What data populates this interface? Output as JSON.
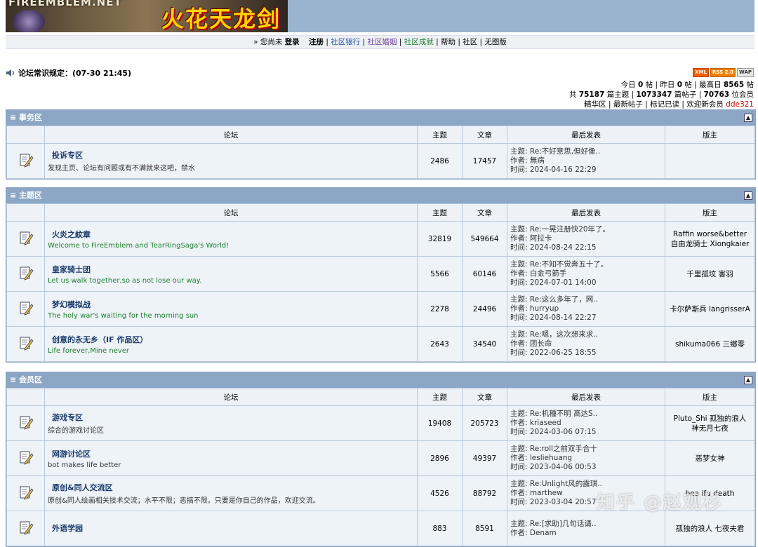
{
  "banner": {
    "logo": "FIREEMBLEM.NET",
    "title": "火花天龙剑"
  },
  "topnav": {
    "prefix": "» 您尚未",
    "login": "登录",
    "register": "注册",
    "items": [
      "社区银行",
      "社区婚姻",
      "社区成就",
      "帮助",
      "社区",
      "无图版"
    ],
    "sep": "|"
  },
  "notice": {
    "text": "论坛常识规定：(07-30 21:45)"
  },
  "badges": [
    "XML",
    "RSS 2.0",
    "WAP"
  ],
  "stats": {
    "today_label": "今日",
    "today": "0",
    "tie": "帖",
    "yesterday_label": "昨日",
    "yesterday": "0",
    "max_label": "最高日",
    "max": "8565",
    "total_label": "共",
    "topics": "75187",
    "topics_unit": "篇主题",
    "posts": "1073347",
    "posts_unit": "篇帖子",
    "members": "70763",
    "members_unit": "位会员",
    "links": [
      "精华区",
      "最新帖子",
      "标记已读"
    ],
    "welcome": "欢迎新会员",
    "newuser": "dde321"
  },
  "headers": {
    "forum": "论坛",
    "topics": "主题",
    "posts": "文章",
    "last": "最后发表",
    "mods": "版主"
  },
  "sections": [
    {
      "title": "≡ 事务区",
      "rows": [
        {
          "name": "投诉专区",
          "desc": "发现主页、论坛有问题或有不满就来这吧，禁水",
          "dark": true,
          "topics": "2486",
          "posts": "17457",
          "l1": "主题: Re:不好意思,但好像..",
          "l2": "作者: 無病",
          "l3": "时间: 2024-04-16 22:29",
          "mod": ""
        }
      ]
    },
    {
      "title": "≡ 主题区",
      "rows": [
        {
          "name": "火炎之紋章",
          "desc": "Welcome to FireEmblem and TearRingSaga's World!",
          "dark": false,
          "topics": "32819",
          "posts": "549664",
          "l1": "主题: Re:一晃注册快20年了。",
          "l2": "作者: 阿拉卡",
          "l3": "时间: 2024-08-24 22:15",
          "mod": "Raffin worse&better\n自由龙骑士 Xiongkaier"
        },
        {
          "name": "皇家骑士团",
          "desc": "Let us walk together,so as not lose our way.",
          "dark": false,
          "topics": "5566",
          "posts": "60146",
          "l1": "主题: Re:不知不觉奔五十了。",
          "l2": "作者: 白金弓箭手",
          "l3": "时间: 2024-07-01 14:00",
          "mod": "千里孤坟 害羽"
        },
        {
          "name": "梦幻模拟战",
          "desc": "The holy war's waiting for the morning sun",
          "dark": false,
          "topics": "2278",
          "posts": "24496",
          "l1": "主题: Re:这么多年了，网..",
          "l2": "作者: hurryup",
          "l3": "时间: 2024-08-14 22:27",
          "mod": "卡尔萨斯兵 langrisserA"
        },
        {
          "name": "创意的永无乡（IF 作品区）",
          "desc": "Life forever,Mine never",
          "dark": false,
          "topics": "2643",
          "posts": "34540",
          "l1": "主题: Re:嗯，这次想来求..",
          "l2": "作者: 团长命",
          "l3": "时间: 2022-06-25 18:55",
          "mod": "shikuma066 三鄉零"
        }
      ]
    },
    {
      "title": "≡ 会员区",
      "rows": [
        {
          "name": "游戏专区",
          "desc": "综合的游戏讨论区",
          "dark": true,
          "topics": "19408",
          "posts": "205723",
          "l1": "主题: Re:机種不明 高达S..",
          "l2": "作者: kriaseed",
          "l3": "时间: 2024-03-06 07:15",
          "mod": "Pluto_Shi 孤独的浪人\n神无月七夜"
        },
        {
          "name": "网游讨论区",
          "desc": "bot makes life better",
          "dark": true,
          "topics": "2896",
          "posts": "49397",
          "l1": "主题: Re:roll之前双手合十",
          "l2": "作者: lesliehuang",
          "l3": "时间: 2023-04-06 00:53",
          "mod": "恶梦女神"
        },
        {
          "name": "原创&同人交流区",
          "desc": "原创&同人绘画相关技术交流；水平不限；恶搞不限。只要是你自己的作品，欢迎交流。",
          "dark": true,
          "topics": "4526",
          "posts": "88792",
          "l1": "主题: Re:Unlight风的露琪..",
          "l2": "作者: marthew",
          "l3": "时间: 2023-03-04 20:57",
          "mod": "bea  ifu  death"
        },
        {
          "name": "外语学园",
          "desc": "",
          "dark": true,
          "topics": "883",
          "posts": "8591",
          "l1": "主题: Re:[求助]几句话请..",
          "l2": "作者: Denam",
          "l3": "",
          "mod": "孤独的浪人 七夜夫君"
        }
      ]
    }
  ],
  "watermark": "知乎 @赵观杉"
}
